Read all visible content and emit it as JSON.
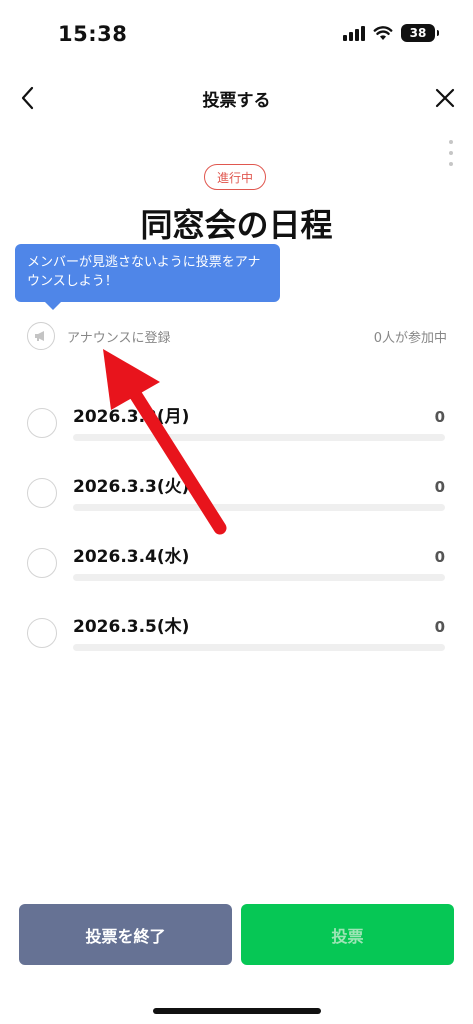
{
  "status_bar": {
    "time": "15:38",
    "battery": "38"
  },
  "header": {
    "title": "投票する"
  },
  "poll": {
    "status_badge": "進行中",
    "title": "同窓会の日程",
    "tooltip": "メンバーが見逃さないように投票をアナウンスしよう！",
    "announce_label": "アナウンスに登録",
    "participant_count": "0人が参加中",
    "options": [
      {
        "label": "2026.3.2(月)",
        "count": "0",
        "fraction": 0
      },
      {
        "label": "2026.3.3(火)",
        "count": "0",
        "fraction": 0
      },
      {
        "label": "2026.3.4(水)",
        "count": "0",
        "fraction": 0
      },
      {
        "label": "2026.3.5(木)",
        "count": "0",
        "fraction": 0
      }
    ]
  },
  "footer": {
    "end_label": "投票を終了",
    "vote_label": "投票"
  },
  "colors": {
    "accent_red": "#e0574f",
    "tooltip_blue": "#4f86e8",
    "end_button": "#667294",
    "vote_button": "#06c755",
    "annotation_arrow": "#e8141c"
  },
  "icons": [
    "back-icon",
    "close-icon",
    "more-icon",
    "megaphone-icon",
    "signal-icon",
    "wifi-icon",
    "battery-icon"
  ]
}
